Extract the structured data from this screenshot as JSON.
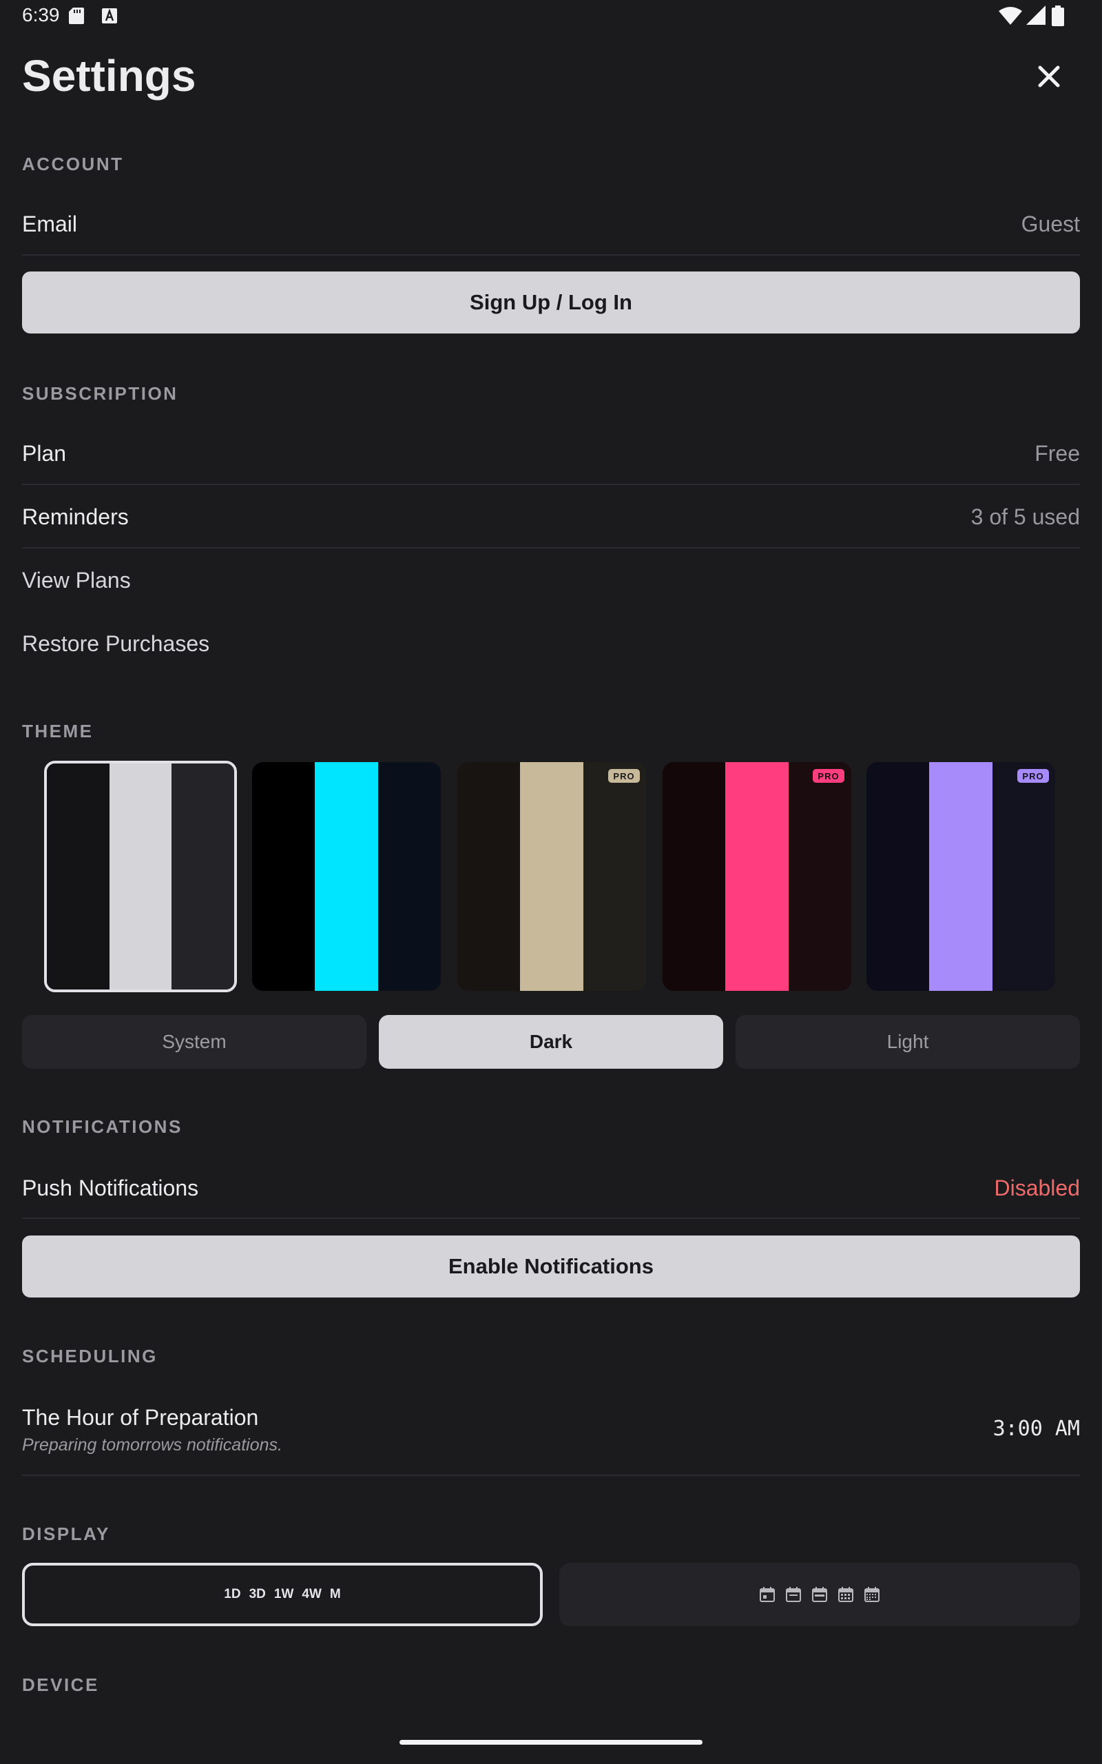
{
  "status_bar": {
    "time": "6:39"
  },
  "header": {
    "title": "Settings"
  },
  "account": {
    "section_title": "ACCOUNT",
    "email_label": "Email",
    "email_value": "Guest",
    "auth_button_label": "Sign Up / Log In"
  },
  "subscription": {
    "section_title": "SUBSCRIPTION",
    "plan_label": "Plan",
    "plan_value": "Free",
    "reminders_label": "Reminders",
    "reminders_value": "3 of 5 used",
    "view_plans_label": "View Plans",
    "restore_label": "Restore Purchases"
  },
  "theme": {
    "section_title": "THEME",
    "swatches": [
      {
        "colors": [
          "#141416",
          "#d4d4d9",
          "#242428"
        ],
        "pro": false,
        "selected": true
      },
      {
        "colors": [
          "#000000",
          "#00e5ff",
          "#0a0f1c"
        ],
        "pro": false,
        "selected": false
      },
      {
        "colors": [
          "#171412",
          "#c7b999",
          "#211f1b"
        ],
        "pro": true,
        "badge_color": "#c7b999",
        "selected": false
      },
      {
        "colors": [
          "#140709",
          "#ff3d7f",
          "#1b0c10"
        ],
        "pro": true,
        "badge_color": "#ff3d7f",
        "selected": false
      },
      {
        "colors": [
          "#0d0c1a",
          "#a88bfa",
          "#13121f"
        ],
        "pro": true,
        "badge_color": "#a88bfa",
        "selected": false
      }
    ],
    "pro_badge_label": "PRO",
    "modes": [
      "System",
      "Dark",
      "Light"
    ],
    "active_mode": "Dark"
  },
  "notifications": {
    "section_title": "NOTIFICATIONS",
    "push_label": "Push Notifications",
    "push_value": "Disabled",
    "enable_button_label": "Enable Notifications"
  },
  "scheduling": {
    "section_title": "SCHEDULING",
    "title": "The Hour of Preparation",
    "subtitle": "Preparing tomorrows notifications.",
    "time": "3:00 AM"
  },
  "display": {
    "section_title": "DISPLAY",
    "ranges": [
      "1D",
      "3D",
      "1W",
      "4W",
      "M"
    ],
    "calendar_icons": [
      "calendar-icon",
      "calendar-icon",
      "calendar-icon",
      "calendar-icon",
      "calendar-icon"
    ]
  },
  "device": {
    "section_title": "DEVICE"
  },
  "colors": {
    "background": "#1b1b1e",
    "button": "#d4d4d9",
    "danger": "#ef6a6a",
    "muted": "#9a9aa0"
  }
}
